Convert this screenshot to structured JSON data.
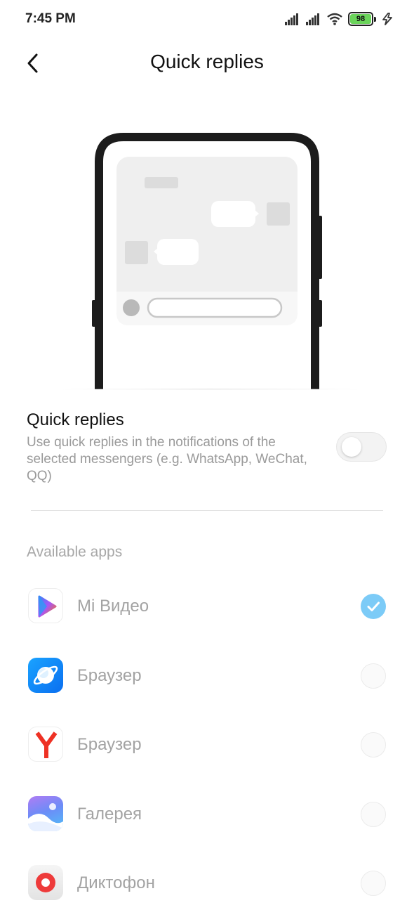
{
  "status_bar": {
    "time": "7:45 PM",
    "battery": "98",
    "icons": [
      "signal-icon",
      "signal-icon",
      "wifi-icon",
      "battery-icon",
      "charging-icon"
    ]
  },
  "header": {
    "title": "Quick replies",
    "back_icon": "back-arrow-icon"
  },
  "quick_replies": {
    "title": "Quick replies",
    "description": "Use quick replies in the notifications of the selected messengers (e.g. WhatsApp, WeChat, QQ)",
    "enabled": false
  },
  "available_apps": {
    "label": "Available apps",
    "apps": [
      {
        "name": "Mi Видео",
        "icon": "mi-video-icon",
        "checked": true
      },
      {
        "name": "Браузер",
        "icon": "browser-planet-icon",
        "checked": false
      },
      {
        "name": "Браузер",
        "icon": "yandex-browser-icon",
        "checked": false
      },
      {
        "name": "Галерея",
        "icon": "gallery-icon",
        "checked": false
      },
      {
        "name": "Диктофон",
        "icon": "recorder-icon",
        "checked": false
      }
    ]
  },
  "colors": {
    "accent": "#7ccbf7",
    "battery": "#6bd45b",
    "muted_text": "#9a9a9a"
  }
}
